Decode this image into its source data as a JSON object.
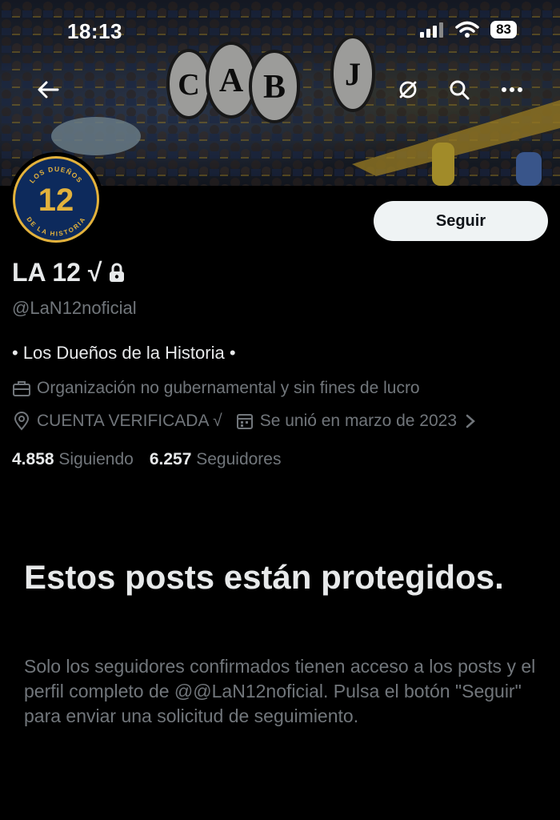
{
  "status_bar": {
    "time": "18:13",
    "battery": "83"
  },
  "banner": {
    "drum_letters": [
      "C",
      "A",
      "B",
      "J"
    ]
  },
  "avatar": {
    "number": "12",
    "ring_top": "LOS DUEÑOS",
    "ring_bottom": "DE LA HISTORIA"
  },
  "follow_button": "Seguir",
  "profile": {
    "name": "LA 12 √",
    "handle": "@LaN12noficial",
    "bio": "• Los Dueños de la Historia •",
    "category": "Organización no gubernamental y sin fines de lucro",
    "location": "CUENTA VERIFICADA √",
    "joined": "Se unió en marzo de 2023"
  },
  "stats": {
    "following_count": "4.858",
    "following_label": "Siguiendo",
    "followers_count": "6.257",
    "followers_label": "Seguidores"
  },
  "protected": {
    "title": "Estos posts están protegidos.",
    "body": "Solo los seguidores confirmados tienen acceso a los posts y el perfil completo de @@LaN12noficial. Pulsa el botón \"Seguir\" para enviar una solicitud de seguimiento."
  },
  "colors": {
    "background": "#000000",
    "text": "#e7e9ea",
    "muted": "#71767b",
    "button": "#eff3f4",
    "gold": "#e3b23c",
    "navy": "#0d2a5c"
  }
}
